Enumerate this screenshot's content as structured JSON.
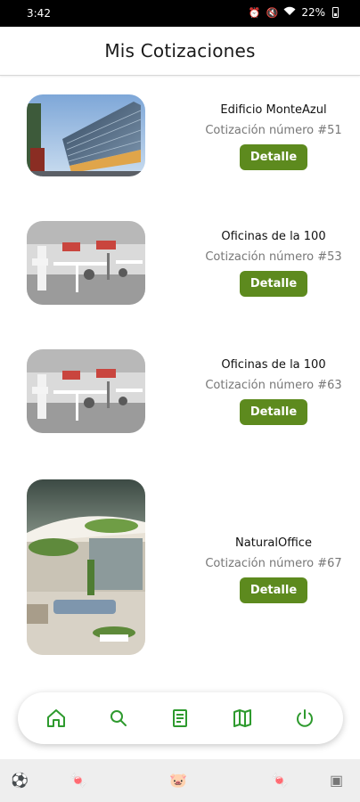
{
  "status_bar": {
    "time": "3:42",
    "battery": "22%",
    "icons": [
      "alarm-icon",
      "mute-icon",
      "wifi-icon",
      "battery-icon"
    ]
  },
  "header": {
    "title": "Mis Cotizaciones"
  },
  "quotes": [
    {
      "name": "Edificio MonteAzul",
      "quote_label": "Cotización número #51",
      "button": "Detalle",
      "image": "modern-glass-building"
    },
    {
      "name": "Oficinas de la 100",
      "quote_label": "Cotización número #53",
      "button": "Detalle",
      "image": "open-office-interior"
    },
    {
      "name": "Oficinas de la 100",
      "quote_label": "Cotización número #63",
      "button": "Detalle",
      "image": "open-office-interior"
    },
    {
      "name": "NaturalOffice",
      "quote_label": "Cotización número #67",
      "button": "Detalle",
      "image": "green-terrace-lounge"
    }
  ],
  "bottom_nav": {
    "items": [
      "home-icon",
      "search-icon",
      "document-icon",
      "map-icon",
      "power-icon"
    ],
    "accent": "#2e9a2e"
  },
  "colors": {
    "button": "#5d8a1e",
    "accent": "#2e9a2e"
  }
}
